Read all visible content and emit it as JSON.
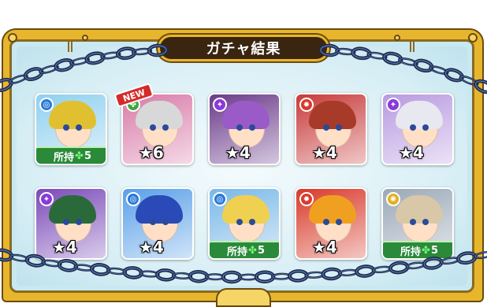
{
  "title": "ガチャ結果",
  "cards": [
    {
      "id": "c1",
      "element": "water",
      "element_color": "#2a7ad8",
      "bg": "#8fd0f0",
      "hair": "#e0c030",
      "stars": "",
      "owned": "所持",
      "owned_count": "5",
      "new": false
    },
    {
      "id": "c2",
      "element": "wood",
      "element_color": "#3aa83a",
      "bg": "#d87aa8",
      "hair": "#d8d8d8",
      "stars": "★6",
      "owned": "",
      "owned_count": "",
      "new": true
    },
    {
      "id": "c3",
      "element": "dark",
      "element_color": "#8a3ad8",
      "bg": "#6a3a8a",
      "hair": "#9a5ac8",
      "stars": "★4",
      "owned": "",
      "owned_count": "",
      "new": false
    },
    {
      "id": "c4",
      "element": "fire",
      "element_color": "#d83a2a",
      "bg": "#c83a3a",
      "hair": "#a83a2a",
      "stars": "★4",
      "owned": "",
      "owned_count": "",
      "new": false
    },
    {
      "id": "c5",
      "element": "dark",
      "element_color": "#8a3ad8",
      "bg": "#b89ae0",
      "hair": "#e8e8f0",
      "stars": "★4",
      "owned": "",
      "owned_count": "",
      "new": false
    },
    {
      "id": "c6",
      "element": "dark",
      "element_color": "#8a3ad8",
      "bg": "#7a4ab8",
      "hair": "#2a6a3a",
      "stars": "★4",
      "owned": "",
      "owned_count": "",
      "new": false
    },
    {
      "id": "c7",
      "element": "water",
      "element_color": "#2a7ad8",
      "bg": "#5aa0e8",
      "hair": "#2a4ab8",
      "stars": "★4",
      "owned": "",
      "owned_count": "",
      "new": false
    },
    {
      "id": "c8",
      "element": "water",
      "element_color": "#2a7ad8",
      "bg": "#78b8e8",
      "hair": "#f0d050",
      "stars": "",
      "owned": "所持",
      "owned_count": "5",
      "new": false
    },
    {
      "id": "c9",
      "element": "fire",
      "element_color": "#d83a2a",
      "bg": "#d83a2a",
      "hair": "#f0a020",
      "stars": "★4",
      "owned": "",
      "owned_count": "",
      "new": false
    },
    {
      "id": "c10",
      "element": "light",
      "element_color": "#e0b020",
      "bg": "#9aa8b8",
      "hair": "#d8c8a8",
      "stars": "",
      "owned": "所持",
      "owned_count": "5",
      "new": false
    }
  ],
  "new_label": "NEW",
  "icons": {
    "element": "element-orb-icon",
    "clover": "clover-icon",
    "star": "star-icon",
    "chain": "chain-icon",
    "bolt": "bolt-icon"
  },
  "colors": {
    "frame": "#e8b62c",
    "frame_dark": "#6a4a10",
    "panel": "#c9e9f1",
    "title_bg": "#3a2510",
    "chain": "#1e2a4a",
    "owned_bg": "#2a8a3a"
  }
}
